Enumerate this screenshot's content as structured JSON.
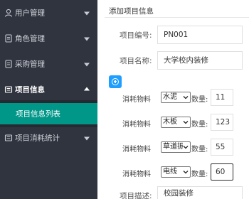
{
  "sidebar": {
    "items": [
      {
        "label": "用户管理",
        "icon": "user-icon",
        "expanded": false
      },
      {
        "label": "角色管理",
        "icon": "document-icon",
        "expanded": false
      },
      {
        "label": "采购管理",
        "icon": "document-icon",
        "expanded": false
      },
      {
        "label": "项目信息",
        "icon": "list-icon",
        "expanded": true
      },
      {
        "label": "项目消耗统计",
        "icon": "list-icon",
        "expanded": false
      }
    ],
    "sub_items": [
      {
        "label": "项目信息列表",
        "active": true
      }
    ],
    "colors": {
      "background": "#30343f",
      "active": "#009688",
      "text": "#d0d3d8"
    }
  },
  "form": {
    "title": "添加项目信息",
    "project_no_label": "项目编号:",
    "project_no_value": "PN001",
    "project_name_label": "项目名称:",
    "project_name_value": "大学校内装修",
    "materials": [
      {
        "label": "消耗物料",
        "material": "水泥",
        "qty_label": "数量:",
        "qty": "11"
      },
      {
        "label": "消耗物料",
        "material": "木板",
        "qty_label": "数量:",
        "qty": "123"
      },
      {
        "label": "消耗物料",
        "material": "草道振",
        "qty_label": "数量:",
        "qty": "55"
      },
      {
        "label": "消耗物料",
        "material": "电线",
        "qty_label": "数量:",
        "qty": "60"
      }
    ],
    "desc_label": "项目描述:",
    "desc_value": "校园装修",
    "colors": {
      "add_button": "#1e9fff"
    }
  }
}
